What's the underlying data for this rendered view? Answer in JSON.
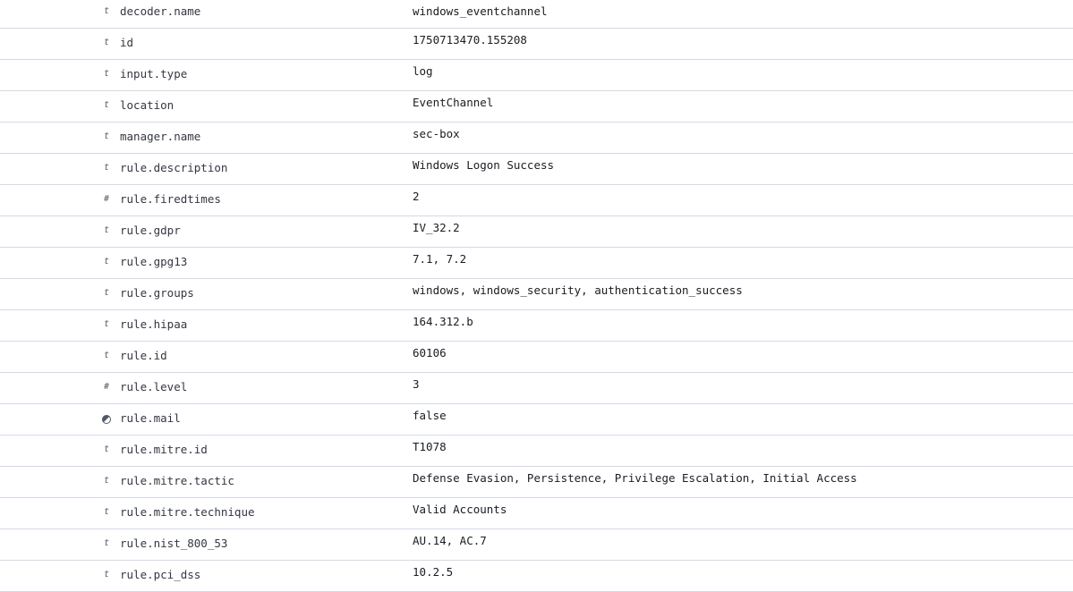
{
  "fields": [
    {
      "type": "t",
      "icon": "string-type-icon",
      "name": "decoder.name",
      "value": "windows_eventchannel"
    },
    {
      "type": "t",
      "icon": "string-type-icon",
      "name": "id",
      "value": "1750713470.155208"
    },
    {
      "type": "t",
      "icon": "string-type-icon",
      "name": "input.type",
      "value": "log"
    },
    {
      "type": "t",
      "icon": "string-type-icon",
      "name": "location",
      "value": "EventChannel"
    },
    {
      "type": "t",
      "icon": "string-type-icon",
      "name": "manager.name",
      "value": "sec-box"
    },
    {
      "type": "t",
      "icon": "string-type-icon",
      "name": "rule.description",
      "value": "Windows Logon Success"
    },
    {
      "type": "#",
      "icon": "number-type-icon",
      "name": "rule.firedtimes",
      "value": "2"
    },
    {
      "type": "t",
      "icon": "string-type-icon",
      "name": "rule.gdpr",
      "value": "IV_32.2"
    },
    {
      "type": "t",
      "icon": "string-type-icon",
      "name": "rule.gpg13",
      "value": "7.1, 7.2"
    },
    {
      "type": "t",
      "icon": "string-type-icon",
      "name": "rule.groups",
      "value": "windows, windows_security, authentication_success"
    },
    {
      "type": "t",
      "icon": "string-type-icon",
      "name": "rule.hipaa",
      "value": "164.312.b"
    },
    {
      "type": "t",
      "icon": "string-type-icon",
      "name": "rule.id",
      "value": "60106"
    },
    {
      "type": "#",
      "icon": "number-type-icon",
      "name": "rule.level",
      "value": "3"
    },
    {
      "type": "boolean",
      "icon": "boolean-type-icon",
      "name": "rule.mail",
      "value": "false"
    },
    {
      "type": "t",
      "icon": "string-type-icon",
      "name": "rule.mitre.id",
      "value": "T1078"
    },
    {
      "type": "t",
      "icon": "string-type-icon",
      "name": "rule.mitre.tactic",
      "value": "Defense Evasion, Persistence, Privilege Escalation, Initial Access"
    },
    {
      "type": "t",
      "icon": "string-type-icon",
      "name": "rule.mitre.technique",
      "value": "Valid Accounts"
    },
    {
      "type": "t",
      "icon": "string-type-icon",
      "name": "rule.nist_800_53",
      "value": "AU.14, AC.7"
    },
    {
      "type": "t",
      "icon": "string-type-icon",
      "name": "rule.pci_dss",
      "value": "10.2.5"
    }
  ]
}
